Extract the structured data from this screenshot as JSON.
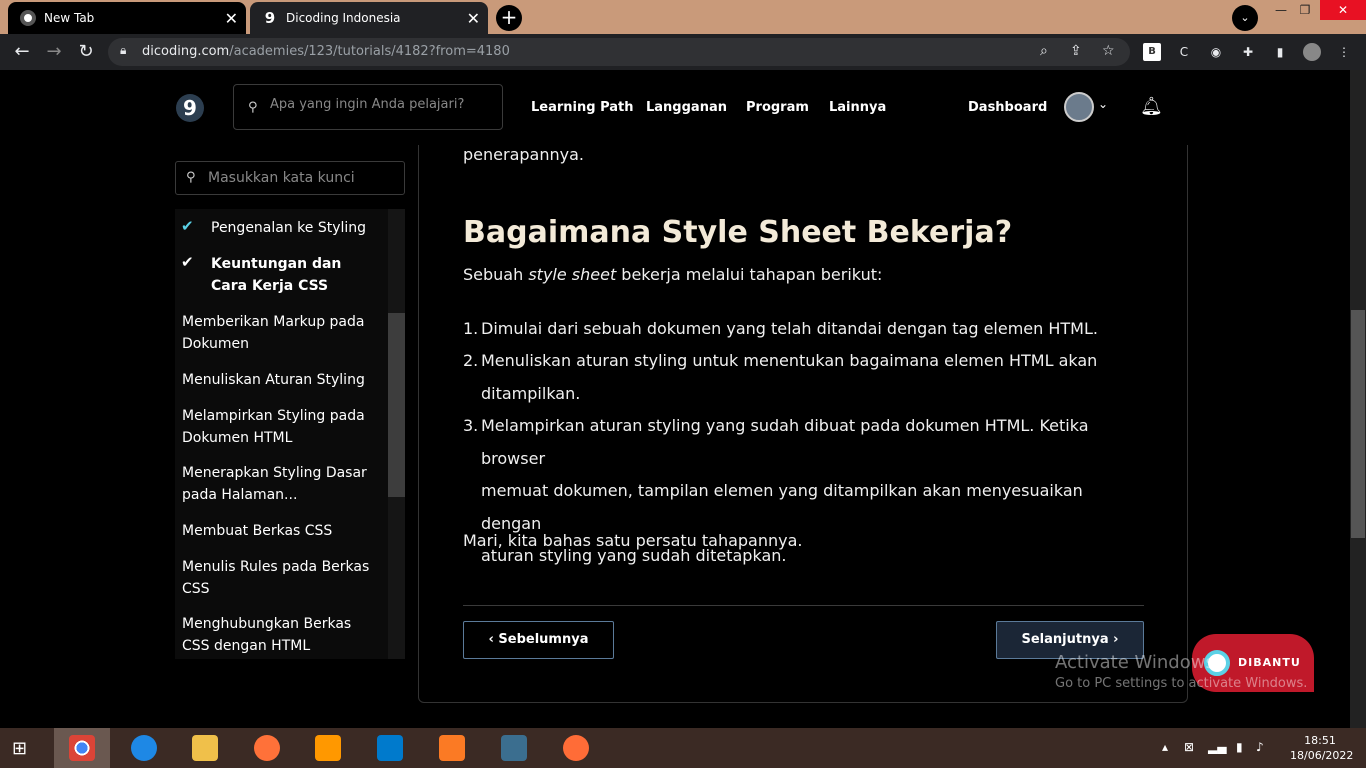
{
  "browser": {
    "tabs": [
      {
        "title": "New Tab",
        "active": false
      },
      {
        "title": "Dicoding Indonesia",
        "active": true
      }
    ],
    "url_host": "dicoding.com",
    "url_path": "/academies/123/tutorials/4182?from=4180"
  },
  "site": {
    "logo_glyph": "9",
    "search_placeholder": "Apa yang ingin Anda pelajari?",
    "nav": [
      "Learning Path",
      "Langganan",
      "Program",
      "Lainnya"
    ],
    "dashboard": "Dashboard"
  },
  "sidebar": {
    "search_placeholder": "Masukkan kata kunci",
    "items": [
      {
        "label": "Pengenalan ke Styling",
        "done": true,
        "bold": false
      },
      {
        "label": "Keuntungan dan Cara Kerja CSS",
        "done": true,
        "bold": true
      },
      {
        "label": "Memberikan Markup pada Dokumen",
        "done": false,
        "bold": false
      },
      {
        "label": "Menuliskan Aturan Styling",
        "done": false,
        "bold": false
      },
      {
        "label": "Melampirkan Styling pada Dokumen HTML",
        "done": false,
        "bold": false
      },
      {
        "label": "Menerapkan Styling Dasar pada Halaman...",
        "done": false,
        "bold": false
      },
      {
        "label": "Membuat Berkas CSS",
        "done": false,
        "bold": false
      },
      {
        "label": "Menulis Rules pada Berkas CSS",
        "done": false,
        "bold": false
      },
      {
        "label": "Menghubungkan Berkas CSS dengan HTML",
        "done": false,
        "bold": false
      }
    ]
  },
  "article": {
    "prev_line": "penerapannya.",
    "heading": "Bagaimana Style Sheet Bekerja?",
    "intro_pre": "Sebuah ",
    "intro_em": "style sheet",
    "intro_post": " bekerja melalui tahapan berikut:",
    "steps": [
      {
        "num": "1.",
        "lines": [
          "Dimulai dari sebuah dokumen yang telah ditandai dengan tag elemen HTML."
        ]
      },
      {
        "num": "2.",
        "lines": [
          "Menuliskan aturan styling untuk menentukan bagaimana elemen HTML akan",
          "ditampilkan."
        ]
      },
      {
        "num": "3.",
        "lines": [
          "Melampirkan aturan styling yang sudah dibuat pada dokumen HTML. Ketika browser",
          "memuat dokumen, tampilan elemen yang ditampilkan akan menyesuaikan dengan",
          "aturan styling yang sudah ditetapkan."
        ]
      }
    ],
    "outro": "Mari, kita bahas satu persatu tahapannya.",
    "prev_button": "Sebelumnya",
    "next_button": "Selanjutnya"
  },
  "dibantu_label": "DIBANTU",
  "watermark": {
    "title": "Activate Windows",
    "subtitle": "Go to PC settings to activate Windows."
  },
  "clock": {
    "time": "18:51",
    "date": "18/06/2022"
  },
  "colors": {
    "accent_check": "#5bd1e6",
    "heading": "#f3ead8",
    "dibantu": "#c0192a"
  }
}
